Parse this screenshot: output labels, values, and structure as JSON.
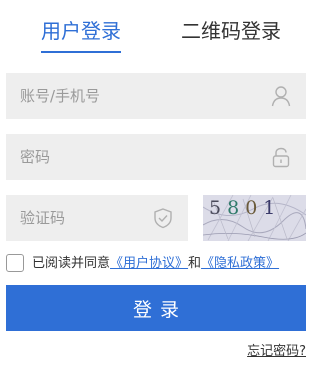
{
  "tabs": {
    "active": "用户登录",
    "qr": "二维码登录"
  },
  "form": {
    "account_placeholder": "账号/手机号",
    "password_placeholder": "密码",
    "captcha_placeholder": "验证码",
    "captcha_code": [
      "5",
      "8",
      "0",
      "1"
    ]
  },
  "agreement": {
    "prefix": "已阅读并同意",
    "user_agreement": "《用户协议》",
    "and": "和",
    "privacy_policy": "《隐私政策》"
  },
  "login_button": "登录",
  "forgot_password": "忘记密码?",
  "colors": {
    "accent": "#2f6fd6",
    "field_bg": "#eeeeee"
  },
  "icons": {
    "account": "user-icon",
    "password": "lock-icon",
    "captcha": "shield-check-icon"
  }
}
